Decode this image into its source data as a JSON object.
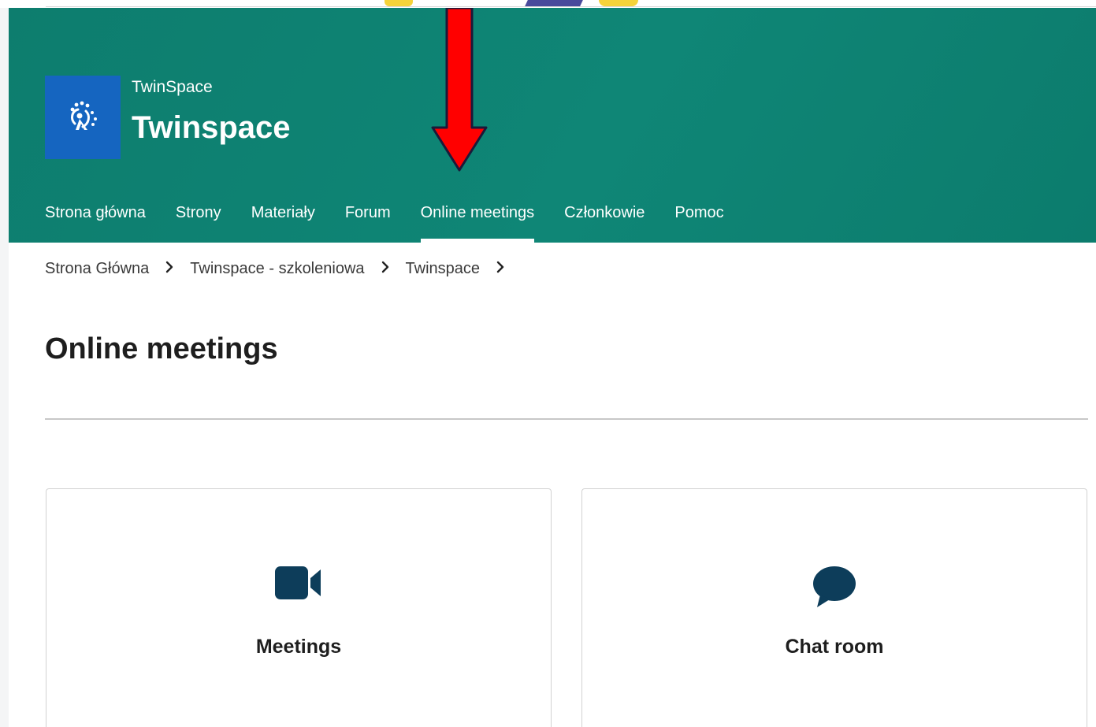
{
  "header": {
    "site_subtitle": "TwinSpace",
    "site_title": "Twinspace",
    "nav": [
      {
        "label": "Strona główna",
        "active": false
      },
      {
        "label": "Strony",
        "active": false
      },
      {
        "label": "Materiały",
        "active": false
      },
      {
        "label": "Forum",
        "active": false
      },
      {
        "label": "Online meetings",
        "active": true
      },
      {
        "label": "Członkowie",
        "active": false
      },
      {
        "label": "Pomoc",
        "active": false
      }
    ]
  },
  "breadcrumb": [
    {
      "label": "Strona Główna"
    },
    {
      "label": "Twinspace - szkoleniowa"
    },
    {
      "label": "Twinspace"
    }
  ],
  "breadcrumb_separator": "›",
  "page": {
    "title": "Online meetings"
  },
  "cards": [
    {
      "label": "Meetings",
      "icon": "video-camera-icon"
    },
    {
      "label": "Chat room",
      "icon": "speech-bubble-icon"
    }
  ],
  "colors": {
    "header_bg": "#0f8676",
    "logo_bg": "#1565c0",
    "icon_color": "#0d3d5a",
    "annotation_arrow": "#ff0000"
  }
}
